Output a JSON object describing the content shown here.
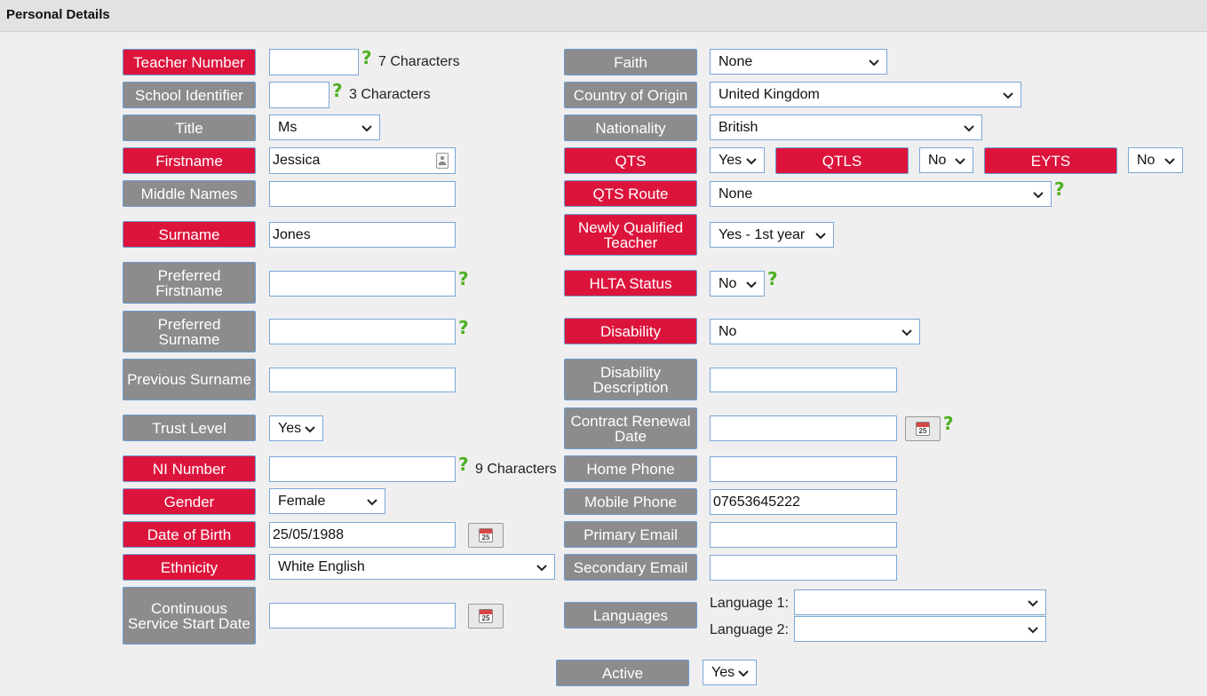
{
  "header": {
    "title": "Personal Details"
  },
  "left": {
    "teacher_number": {
      "label": "Teacher Number",
      "value": "",
      "hint": "7 Characters"
    },
    "school_identifier": {
      "label": "School Identifier",
      "value": "",
      "hint": "3 Characters"
    },
    "title": {
      "label": "Title",
      "value": "Ms"
    },
    "firstname": {
      "label": "Firstname",
      "value": "Jessica"
    },
    "middle_names": {
      "label": "Middle Names",
      "value": ""
    },
    "surname": {
      "label": "Surname",
      "value": "Jones"
    },
    "preferred_firstname": {
      "label": "Preferred Firstname",
      "value": ""
    },
    "preferred_surname": {
      "label": "Preferred Surname",
      "value": ""
    },
    "previous_surname": {
      "label": "Previous Surname",
      "value": ""
    },
    "trust_level": {
      "label": "Trust Level",
      "value": "Yes"
    },
    "ni_number": {
      "label": "NI Number",
      "value": "",
      "hint": "9 Characters"
    },
    "gender": {
      "label": "Gender",
      "value": "Female"
    },
    "date_of_birth": {
      "label": "Date of Birth",
      "value": "25/05/1988"
    },
    "ethnicity": {
      "label": "Ethnicity",
      "value": "White English"
    },
    "continuous_service": {
      "label": "Continuous Service Start Date",
      "value": ""
    }
  },
  "right": {
    "faith": {
      "label": "Faith",
      "value": "None"
    },
    "country_of_origin": {
      "label": "Country of Origin",
      "value": "United Kingdom"
    },
    "nationality": {
      "label": "Nationality",
      "value": "British"
    },
    "qts": {
      "label": "QTS",
      "value": "Yes"
    },
    "qtls": {
      "label": "QTLS",
      "value": "No"
    },
    "eyts": {
      "label": "EYTS",
      "value": "No"
    },
    "qts_route": {
      "label": "QTS Route",
      "value": "None"
    },
    "nqt": {
      "label": "Newly Qualified Teacher",
      "value": "Yes - 1st year"
    },
    "hlta_status": {
      "label": "HLTA Status",
      "value": "No"
    },
    "disability": {
      "label": "Disability",
      "value": "No"
    },
    "disability_description": {
      "label": "Disability Description",
      "value": ""
    },
    "contract_renewal_date": {
      "label": "Contract Renewal Date",
      "value": ""
    },
    "home_phone": {
      "label": "Home Phone",
      "value": ""
    },
    "mobile_phone": {
      "label": "Mobile Phone",
      "value": "07653645222"
    },
    "primary_email": {
      "label": "Primary Email",
      "value": ""
    },
    "secondary_email": {
      "label": "Secondary Email",
      "value": ""
    },
    "languages": {
      "label": "Languages",
      "language1_label": "Language 1:",
      "language1_value": "",
      "language2_label": "Language 2:",
      "language2_value": ""
    }
  },
  "active": {
    "label": "Active",
    "value": "Yes"
  },
  "calendar_icon_text": "25",
  "help_icon": "?",
  "colors": {
    "required": "#dc143c",
    "optional": "#8c8c8c",
    "help": "#4caf1f"
  }
}
